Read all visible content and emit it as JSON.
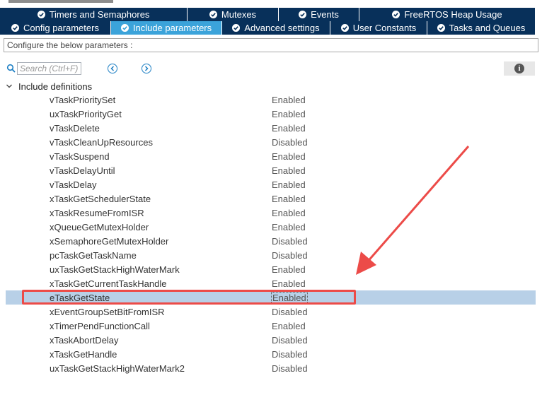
{
  "tabs_row1": [
    {
      "label": "Timers and Semaphores",
      "active": false
    },
    {
      "label": "Mutexes",
      "active": false
    },
    {
      "label": "Events",
      "active": false
    },
    {
      "label": "FreeRTOS Heap Usage",
      "active": false
    }
  ],
  "tabs_row2": [
    {
      "label": "Config parameters",
      "active": false
    },
    {
      "label": "Include parameters",
      "active": true
    },
    {
      "label": "Advanced settings",
      "active": false
    },
    {
      "label": "User Constants",
      "active": false
    },
    {
      "label": "Tasks and Queues",
      "active": false
    }
  ],
  "description": "Configure the below parameters :",
  "search": {
    "placeholder": "Search (Ctrl+F)",
    "value": ""
  },
  "group": {
    "label": "Include definitions",
    "expanded": true
  },
  "parameters": [
    {
      "name": "vTaskPrioritySet",
      "value": "Enabled"
    },
    {
      "name": "uxTaskPriorityGet",
      "value": "Enabled"
    },
    {
      "name": "vTaskDelete",
      "value": "Enabled"
    },
    {
      "name": "vTaskCleanUpResources",
      "value": "Disabled"
    },
    {
      "name": "vTaskSuspend",
      "value": "Enabled"
    },
    {
      "name": "vTaskDelayUntil",
      "value": "Enabled"
    },
    {
      "name": "vTaskDelay",
      "value": "Enabled"
    },
    {
      "name": "xTaskGetSchedulerState",
      "value": "Enabled"
    },
    {
      "name": "xTaskResumeFromISR",
      "value": "Enabled"
    },
    {
      "name": "xQueueGetMutexHolder",
      "value": "Enabled"
    },
    {
      "name": "xSemaphoreGetMutexHolder",
      "value": "Disabled"
    },
    {
      "name": "pcTaskGetTaskName",
      "value": "Disabled"
    },
    {
      "name": "uxTaskGetStackHighWaterMark",
      "value": "Enabled"
    },
    {
      "name": "xTaskGetCurrentTaskHandle",
      "value": "Enabled"
    },
    {
      "name": "eTaskGetState",
      "value": "Enabled",
      "selected": true
    },
    {
      "name": "xEventGroupSetBitFromISR",
      "value": "Disabled"
    },
    {
      "name": "xTimerPendFunctionCall",
      "value": "Enabled"
    },
    {
      "name": "xTaskAbortDelay",
      "value": "Disabled"
    },
    {
      "name": "xTaskGetHandle",
      "value": "Disabled"
    },
    {
      "name": "uxTaskGetStackHighWaterMark2",
      "value": "Disabled"
    }
  ],
  "colors": {
    "tab_bg": "#08305a",
    "tab_active_bg": "#3ba3da",
    "selected_row_bg": "#b8d0e7",
    "annotation_red": "#ec4b48"
  }
}
